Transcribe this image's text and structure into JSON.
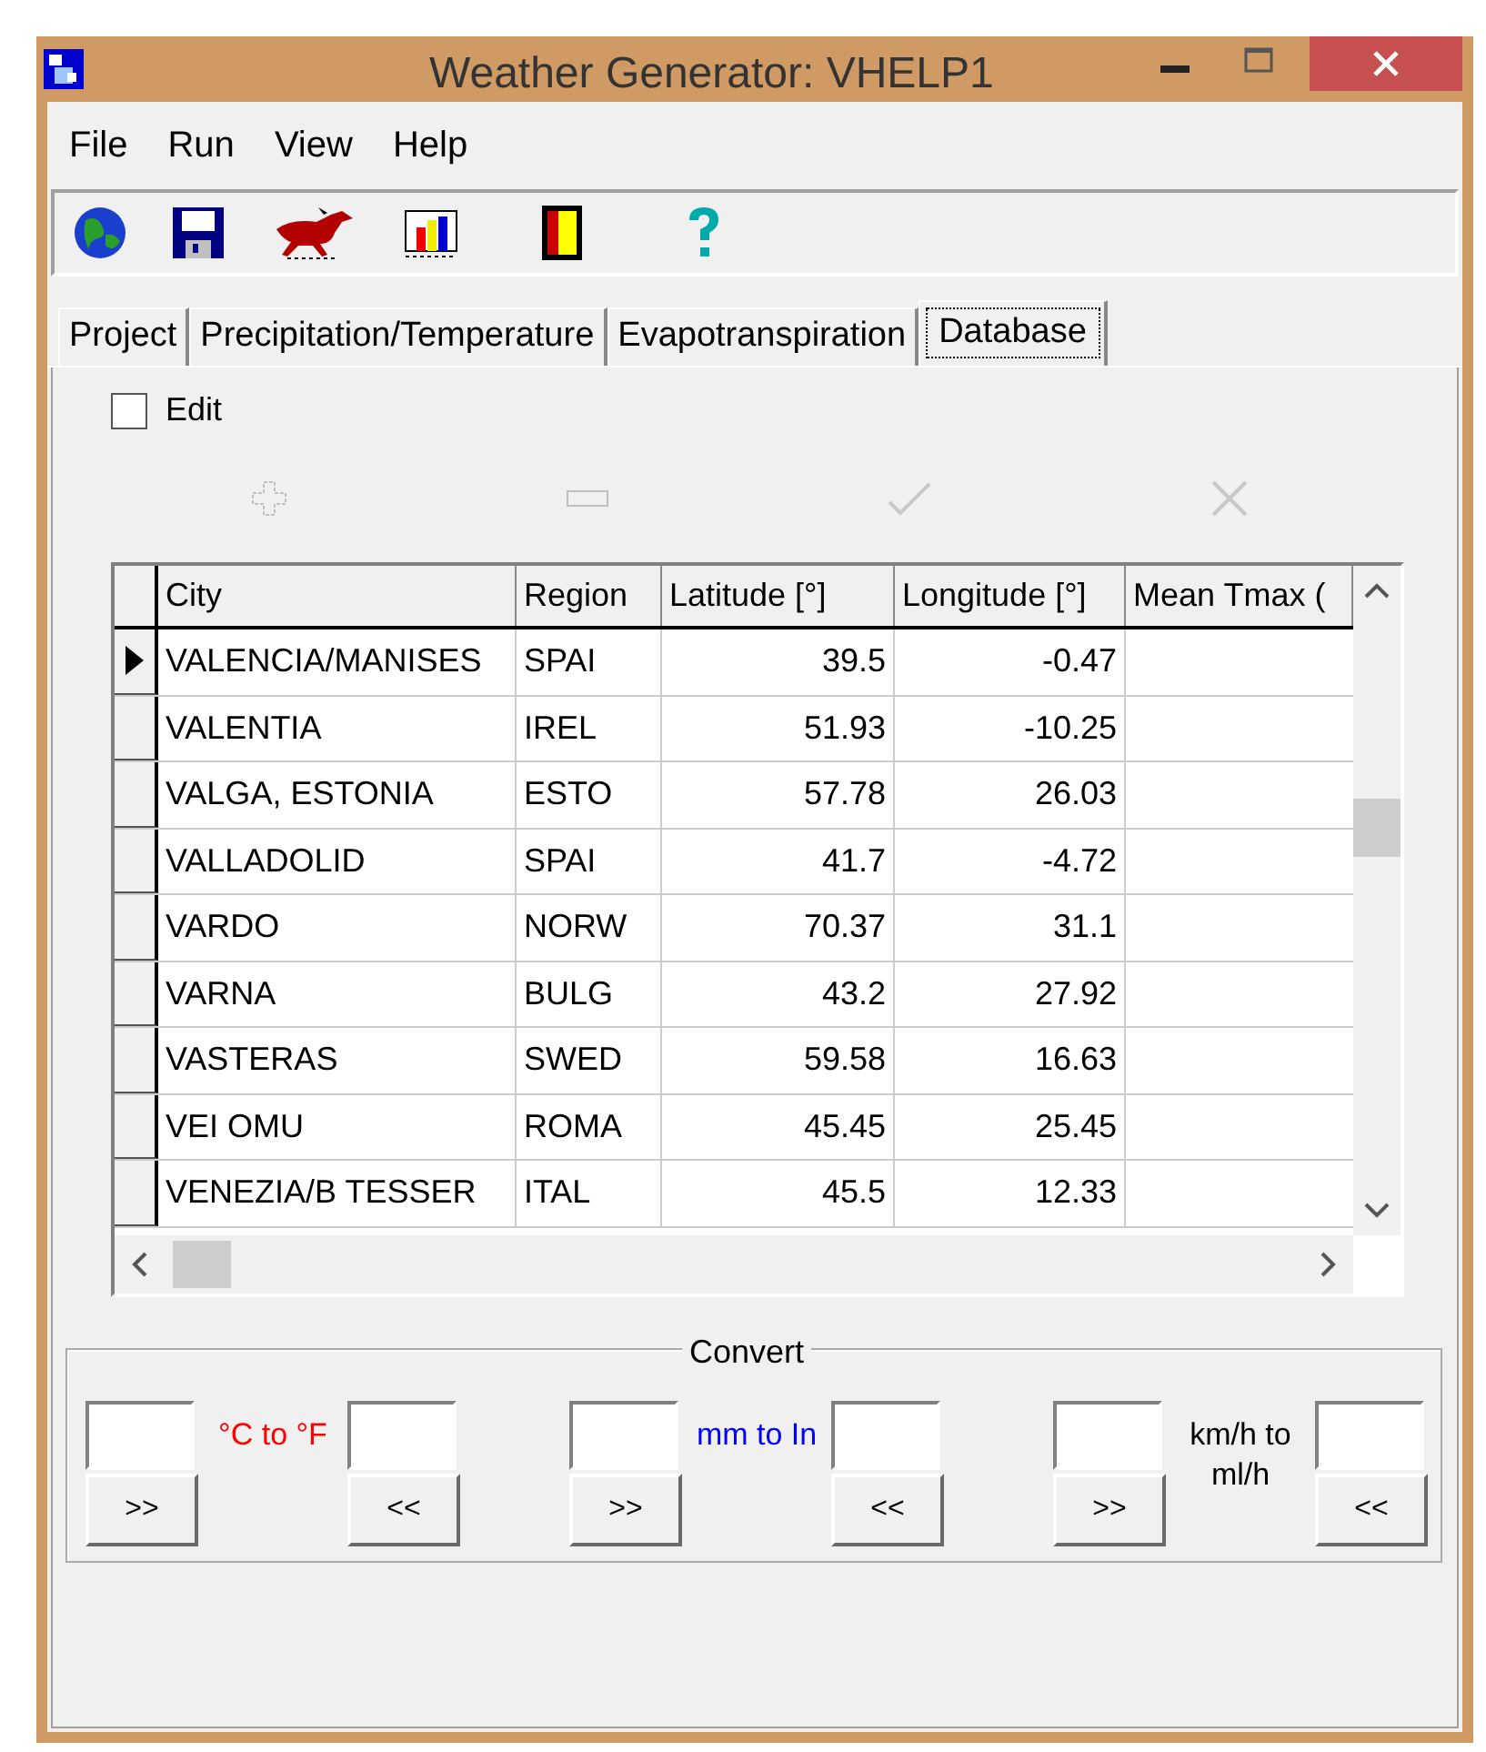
{
  "window": {
    "title": "Weather Generator: VHELP1"
  },
  "menu": [
    "File",
    "Run",
    "View",
    "Help"
  ],
  "tabs": [
    {
      "label": "Project",
      "selected": false
    },
    {
      "label": "Precipitation/Temperature",
      "selected": false
    },
    {
      "label": "Evapotranspiration",
      "selected": false
    },
    {
      "label": "Database",
      "selected": true
    }
  ],
  "edit_checkbox": {
    "label": "Edit",
    "checked": false
  },
  "table": {
    "columns": [
      "City",
      "Region",
      "Latitude [°]",
      "Longitude [°]",
      "Mean Tmax ("
    ],
    "rows": [
      {
        "selected": true,
        "cells": [
          "VALENCIA/MANISES",
          "SPAI",
          "39.5",
          "-0.47"
        ]
      },
      {
        "selected": false,
        "cells": [
          "VALENTIA",
          "IREL",
          "51.93",
          "-10.25"
        ]
      },
      {
        "selected": false,
        "cells": [
          "VALGA, ESTONIA",
          "ESTO",
          "57.78",
          "26.03"
        ]
      },
      {
        "selected": false,
        "cells": [
          "VALLADOLID",
          "SPAI",
          "41.7",
          "-4.72"
        ]
      },
      {
        "selected": false,
        "cells": [
          "VARDO",
          "NORW",
          "70.37",
          "31.1"
        ]
      },
      {
        "selected": false,
        "cells": [
          "VARNA",
          "BULG",
          "43.2",
          "27.92"
        ]
      },
      {
        "selected": false,
        "cells": [
          "VASTERAS",
          "SWED",
          "59.58",
          "16.63"
        ]
      },
      {
        "selected": false,
        "cells": [
          "VEI OMU",
          "ROMA",
          "45.45",
          "25.45"
        ]
      },
      {
        "selected": false,
        "cells": [
          "VENEZIA/B TESSER",
          "ITAL",
          "45.5",
          "12.33"
        ]
      }
    ]
  },
  "convert": {
    "title": "Convert",
    "converters": [
      {
        "label": "°C to °F",
        "color": "#ff0000",
        "forward": ">>",
        "back": "<<"
      },
      {
        "label": "mm to In",
        "color": "#0000ff",
        "forward": ">>",
        "back": "<<"
      },
      {
        "label": "km/h to ml/h",
        "color": "#000000",
        "forward": ">>",
        "back": "<<"
      }
    ]
  }
}
